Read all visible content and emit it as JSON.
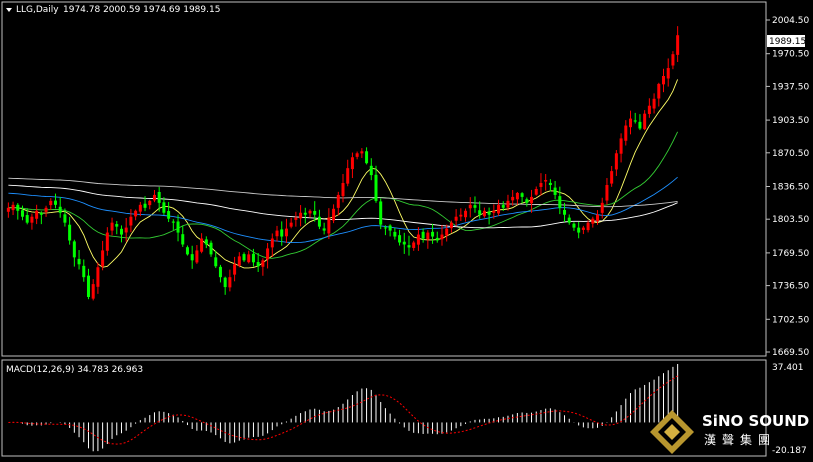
{
  "header": {
    "symbol_label": "LLG,Daily",
    "ohlc": "1974.78 2000.59 1974.69 1989.15",
    "macd_label": "MACD(12,26,9) 34.783 26.963"
  },
  "price_tag": "1989.15",
  "colors": {
    "background": "#000000",
    "bull": "#ff0000",
    "bear": "#00ff00",
    "ma_yellow": "#ffff66",
    "ma_green": "#33cc33",
    "ma_blue": "#1e90ff",
    "ma_white": "#ffffff",
    "ma_gray": "#c8c8c8",
    "macd_hist": "#ffffff",
    "macd_signal": "#ff0000"
  },
  "logo": {
    "text_en": "SiNO SOUND",
    "text_cn": "漢聲集團"
  },
  "chart_data": [
    {
      "type": "candlestick",
      "title": "LLG,Daily",
      "ylim": [
        1669.5,
        2004.5
      ],
      "y_ticks": [
        "2004.50",
        "1970.50",
        "1937.50",
        "1903.50",
        "1870.50",
        "1836.50",
        "1803.50",
        "1769.50",
        "1736.50",
        "1702.50",
        "1669.50"
      ],
      "y_tick_values": [
        2004.5,
        1970.5,
        1937.5,
        1903.5,
        1870.5,
        1836.5,
        1803.5,
        1769.5,
        1736.5,
        1702.5,
        1669.5
      ],
      "close": [
        1815,
        1818,
        1812,
        1806,
        1800,
        1806,
        1812,
        1808,
        1815,
        1822,
        1818,
        1810,
        1800,
        1782,
        1765,
        1758,
        1745,
        1725,
        1738,
        1755,
        1772,
        1790,
        1800,
        1796,
        1788,
        1795,
        1806,
        1812,
        1818,
        1815,
        1822,
        1828,
        1820,
        1810,
        1804,
        1800,
        1790,
        1778,
        1768,
        1762,
        1772,
        1784,
        1778,
        1768,
        1756,
        1745,
        1735,
        1745,
        1758,
        1766,
        1762,
        1768,
        1760,
        1756,
        1762,
        1774,
        1784,
        1792,
        1786,
        1794,
        1800,
        1805,
        1810,
        1808,
        1812,
        1808,
        1796,
        1792,
        1805,
        1814,
        1828,
        1840,
        1855,
        1866,
        1870,
        1872,
        1860,
        1848,
        1822,
        1798,
        1795,
        1792,
        1786,
        1780,
        1778,
        1775,
        1780,
        1788,
        1784,
        1790,
        1786,
        1782,
        1788,
        1794,
        1800,
        1806,
        1808,
        1812,
        1818,
        1815,
        1808,
        1812,
        1808,
        1812,
        1818,
        1815,
        1822,
        1826,
        1830,
        1826,
        1820,
        1826,
        1834,
        1840,
        1843,
        1838,
        1828,
        1815,
        1808,
        1800,
        1795,
        1790,
        1795,
        1800,
        1804,
        1808,
        1820,
        1838,
        1852,
        1870,
        1885,
        1898,
        1905,
        1902,
        1895,
        1910,
        1918,
        1925,
        1940,
        1948,
        1956,
        1970,
        1989.15
      ],
      "volume_note": "",
      "moving_averages": [
        {
          "color_key": "ma_yellow"
        },
        {
          "color_key": "ma_green"
        },
        {
          "color_key": "ma_blue"
        },
        {
          "color_key": "ma_white"
        },
        {
          "color_key": "ma_gray"
        }
      ],
      "ma_periods": [
        8,
        20,
        50,
        100,
        200
      ]
    },
    {
      "type": "bar",
      "title": "MACD(12,26,9) 34.783 26.963",
      "ylim": [
        -20.187,
        37.401
      ],
      "y_ticks": [
        "37.401",
        "-20.187"
      ],
      "y_tick_values": [
        37.401,
        -20.187
      ],
      "main_value": 34.783,
      "signal_value": 26.963
    }
  ]
}
